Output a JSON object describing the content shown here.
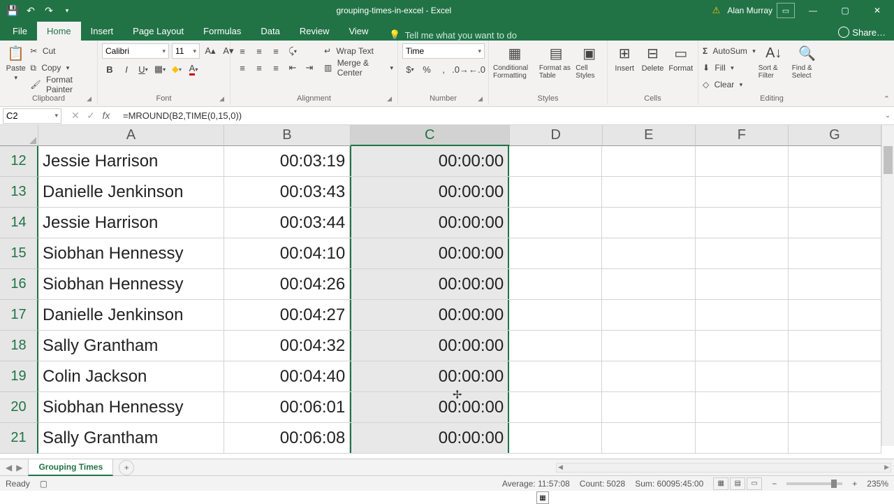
{
  "title": "grouping-times-in-excel - Excel",
  "user": "Alan Murray",
  "tabs": [
    "File",
    "Home",
    "Insert",
    "Page Layout",
    "Formulas",
    "Data",
    "Review",
    "View"
  ],
  "active_tab": "Home",
  "tellme": "Tell me what you want to do",
  "share": "Share…",
  "clipboard": {
    "paste": "Paste",
    "cut": "Cut",
    "copy": "Copy",
    "painter": "Format Painter",
    "label": "Clipboard"
  },
  "font": {
    "name": "Calibri",
    "size": "11",
    "label": "Font"
  },
  "alignment": {
    "wrap": "Wrap Text",
    "merge": "Merge & Center",
    "label": "Alignment"
  },
  "number": {
    "format": "Time",
    "label": "Number"
  },
  "styles": {
    "cond": "Conditional Formatting",
    "table": "Format as Table",
    "cell": "Cell Styles",
    "label": "Styles"
  },
  "cells": {
    "insert": "Insert",
    "delete": "Delete",
    "format": "Format",
    "label": "Cells"
  },
  "editing": {
    "autosum": "AutoSum",
    "fill": "Fill",
    "clear": "Clear",
    "sort": "Sort & Filter",
    "find": "Find & Select",
    "label": "Editing"
  },
  "namebox": "C2",
  "formula": "=MROUND(B2,TIME(0,15,0))",
  "cols": {
    "a_w": 280,
    "b_w": 190,
    "c_w": 240,
    "rest_w": 140
  },
  "col_headers": [
    "A",
    "B",
    "C",
    "D",
    "E",
    "F",
    "G"
  ],
  "selected_col_index": 2,
  "rows": [
    {
      "n": 12,
      "a": "Jessie Harrison",
      "b": "00:03:19",
      "c": "00:00:00"
    },
    {
      "n": 13,
      "a": "Danielle Jenkinson",
      "b": "00:03:43",
      "c": "00:00:00"
    },
    {
      "n": 14,
      "a": "Jessie Harrison",
      "b": "00:03:44",
      "c": "00:00:00"
    },
    {
      "n": 15,
      "a": "Siobhan Hennessy",
      "b": "00:04:10",
      "c": "00:00:00"
    },
    {
      "n": 16,
      "a": "Siobhan Hennessy",
      "b": "00:04:26",
      "c": "00:00:00"
    },
    {
      "n": 17,
      "a": "Danielle Jenkinson",
      "b": "00:04:27",
      "c": "00:00:00"
    },
    {
      "n": 18,
      "a": "Sally Grantham",
      "b": "00:04:32",
      "c": "00:00:00"
    },
    {
      "n": 19,
      "a": "Colin Jackson",
      "b": "00:04:40",
      "c": "00:00:00"
    },
    {
      "n": 20,
      "a": "Siobhan Hennessy",
      "b": "00:06:01",
      "c": "00:00:00"
    },
    {
      "n": 21,
      "a": "Sally Grantham",
      "b": "00:06:08",
      "c": "00:00:00"
    }
  ],
  "sheet": "Grouping Times",
  "status": {
    "ready": "Ready",
    "avg": "Average: 11:57:08",
    "count": "Count: 5028",
    "sum": "Sum: 60095:45:00",
    "zoom": "235%"
  }
}
